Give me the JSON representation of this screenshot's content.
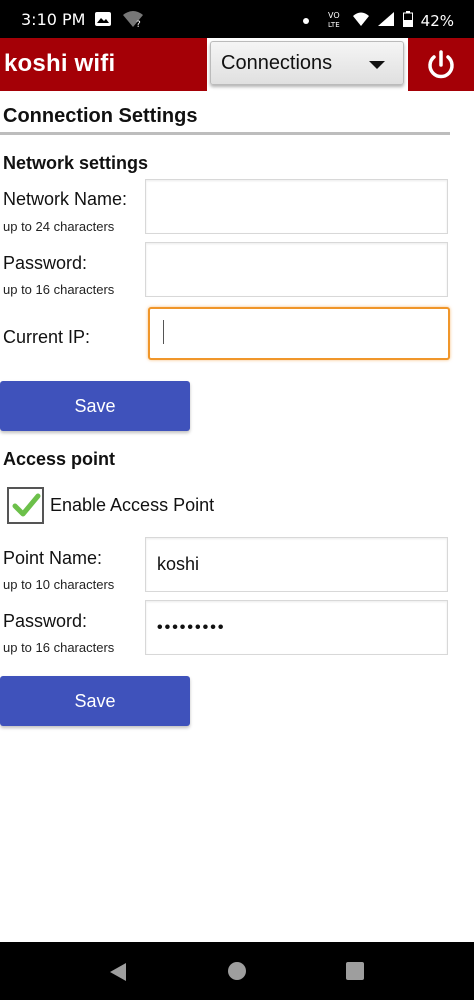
{
  "status_bar": {
    "time": "3:10 PM",
    "battery": "42%",
    "icons": [
      "image-icon",
      "wifi-question-icon",
      "dot-icon",
      "volte-icon",
      "signal-icon",
      "battery-icon"
    ]
  },
  "app_bar": {
    "title": "koshi wifi",
    "dropdown_selected": "Connections",
    "power_icon": "power-icon",
    "accent_color": "#a40006"
  },
  "page": {
    "title": "Connection Settings"
  },
  "network_settings": {
    "heading": "Network settings",
    "network_name": {
      "label": "Network Name:",
      "hint": "up to 24 characters",
      "value": ""
    },
    "password": {
      "label": "Password:",
      "hint": "up to 16 characters",
      "value": ""
    },
    "current_ip": {
      "label": "Current IP:",
      "value": ""
    },
    "save_label": "Save"
  },
  "access_point": {
    "heading": "Access point",
    "enable_label": "Enable Access Point",
    "enabled": true,
    "point_name": {
      "label": "Point Name:",
      "hint": "up to 10 characters",
      "value": "koshi"
    },
    "password": {
      "label": "Password:",
      "hint": "up to 16 characters",
      "value": "•••••••••"
    },
    "save_label": "Save",
    "button_color": "#3f52bb"
  },
  "nav_bar": {
    "icons": [
      "back-icon",
      "home-icon",
      "recents-icon"
    ]
  }
}
